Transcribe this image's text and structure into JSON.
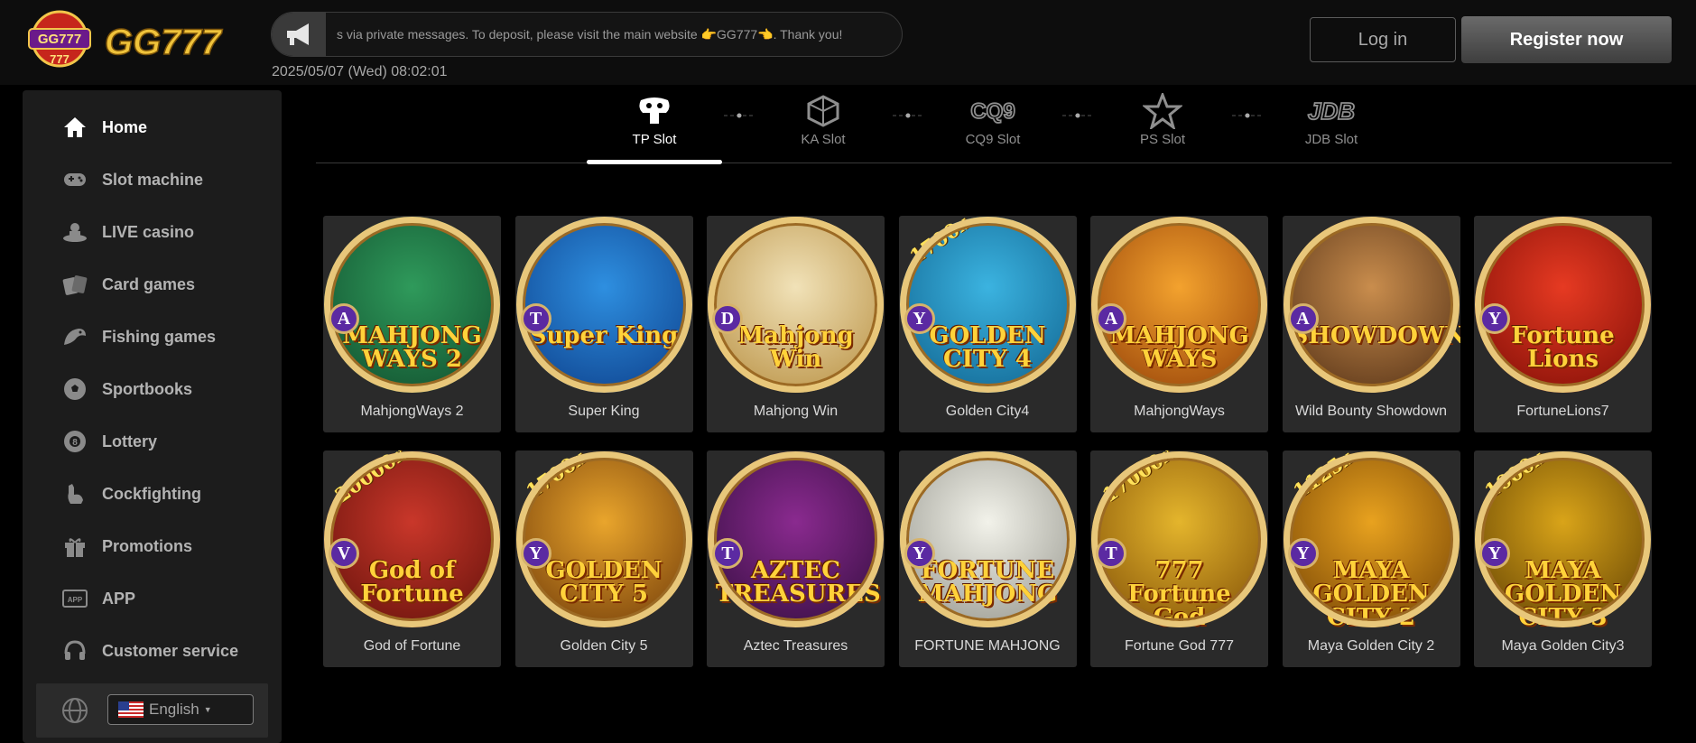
{
  "header": {
    "logo_text": "GG777",
    "announcement": "s via private messages. To deposit, please visit the main website 👉GG777👈. Thank you!",
    "datetime": "2025/05/07 (Wed) 08:02:01",
    "login_label": "Log in",
    "register_label": "Register now"
  },
  "sidebar": {
    "items": [
      {
        "label": "Home",
        "icon": "home-icon"
      },
      {
        "label": "Slot machine",
        "icon": "gamepad-icon"
      },
      {
        "label": "LIVE casino",
        "icon": "dealer-icon"
      },
      {
        "label": "Card games",
        "icon": "cards-icon"
      },
      {
        "label": "Fishing games",
        "icon": "fish-icon"
      },
      {
        "label": "Sportbooks",
        "icon": "soccer-ball-icon"
      },
      {
        "label": "Lottery",
        "icon": "lottery-ball-icon"
      },
      {
        "label": "Cockfighting",
        "icon": "rooster-icon"
      },
      {
        "label": "Promotions",
        "icon": "gift-icon"
      },
      {
        "label": "APP",
        "icon": "app-icon"
      },
      {
        "label": "Customer service",
        "icon": "headset-icon"
      }
    ],
    "language": "English"
  },
  "providers": [
    {
      "label": "TP Slot",
      "logo": "TP"
    },
    {
      "label": "KA Slot",
      "logo": "KA"
    },
    {
      "label": "CQ9 Slot",
      "logo": "CQ9"
    },
    {
      "label": "PS Slot",
      "logo": "PS"
    },
    {
      "label": "JDB Slot",
      "logo": "JDB"
    }
  ],
  "games": [
    {
      "name": "MahjongWays 2",
      "badge": "A",
      "art": "MAHJONG WAYS 2",
      "colors": [
        "#2f9a5b",
        "#0f4a2b"
      ]
    },
    {
      "name": "Super King",
      "badge": "T",
      "art": "Super King",
      "colors": [
        "#2e8fe0",
        "#0b3b86"
      ]
    },
    {
      "name": "Mahjong Win",
      "badge": "D",
      "art": "Mahjong Win",
      "colors": [
        "#f1e2b8",
        "#b48a3a"
      ]
    },
    {
      "name": "Golden City4",
      "badge": "Y",
      "art": "GOLDEN CITY 4",
      "colors": [
        "#3bb3e0",
        "#0d5e8a"
      ]
    },
    {
      "name": "MahjongWays",
      "badge": "A",
      "art": "MAHJONG WAYS",
      "colors": [
        "#f3a22e",
        "#8f3a05"
      ]
    },
    {
      "name": "Wild Bounty Showdown",
      "badge": "A",
      "art": "SHOWDOWN",
      "colors": [
        "#c98d4d",
        "#4b2a12"
      ]
    },
    {
      "name": "FortuneLions7",
      "badge": "Y",
      "art": "Fortune Lions",
      "colors": [
        "#e63a22",
        "#7a0b05"
      ]
    },
    {
      "name": "God of Fortune",
      "badge": "V",
      "art": "God of Fortune",
      "colors": [
        "#c9372a",
        "#5e0f09"
      ]
    },
    {
      "name": "Golden City 5",
      "badge": "Y",
      "art": "GOLDEN CITY 5",
      "colors": [
        "#e9a52c",
        "#6a3507"
      ]
    },
    {
      "name": "Aztec Treasures",
      "badge": "T",
      "art": "AZTEC TREASURES",
      "colors": [
        "#8a2a8f",
        "#2e0c3a"
      ]
    },
    {
      "name": "FORTUNE MAHJONG",
      "badge": "Y",
      "art": "FORTUNE MAHJONG",
      "colors": [
        "#f2f2ea",
        "#8f8f86"
      ]
    },
    {
      "name": "Fortune God 777",
      "badge": "T",
      "art": "777 Fortune God",
      "colors": [
        "#e4b52c",
        "#7c4a05"
      ]
    },
    {
      "name": "Maya Golden City 2",
      "badge": "Y",
      "art": "MAYA GOLDEN CITY 2",
      "colors": [
        "#e8a21f",
        "#6e3d02"
      ]
    },
    {
      "name": "Maya Golden City3",
      "badge": "Y",
      "art": "MAYA GOLDEN CITY 3",
      "colors": [
        "#d9a419",
        "#5a3b02"
      ]
    }
  ],
  "art_numbers": [
    "1700x",
    "1700x",
    "20000x",
    "17000x",
    "1125x",
    "1000x"
  ]
}
